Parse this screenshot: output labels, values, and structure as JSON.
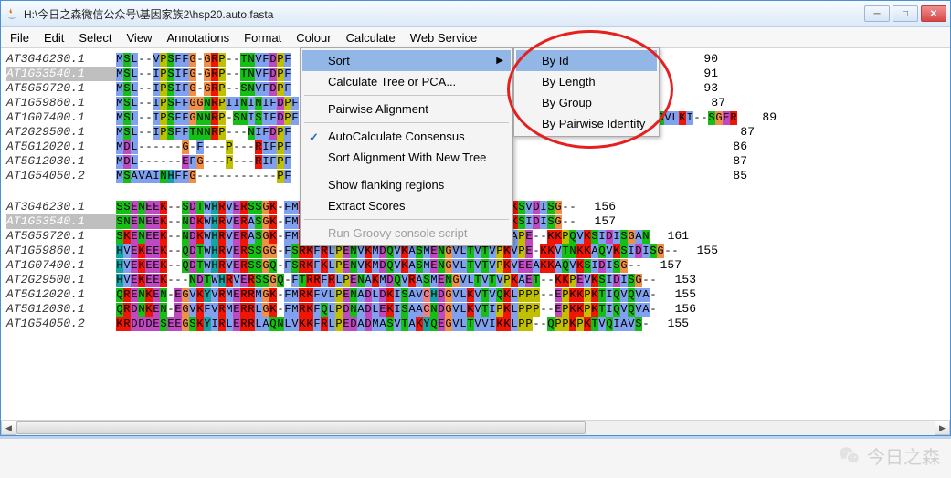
{
  "window": {
    "title": "H:\\今日之森微信公众号\\基因家族2\\hsp20.auto.fasta"
  },
  "menubar": [
    "File",
    "Edit",
    "Select",
    "View",
    "Annotations",
    "Format",
    "Colour",
    "Calculate",
    "Web Service"
  ],
  "calc_menu": {
    "sort": "Sort",
    "calc_tree": "Calculate Tree or PCA...",
    "pairwise": "Pairwise Alignment",
    "autocalc": "AutoCalculate Consensus",
    "sort_new": "Sort Alignment With New Tree",
    "flanking": "Show flanking regions",
    "extract": "Extract Scores",
    "groovy": "Run Groovy console script"
  },
  "sort_menu": {
    "by_id": "By Id",
    "by_length": "By Length",
    "by_group": "By Group",
    "by_pair": "By Pairwise Identity"
  },
  "block1": {
    "names": [
      "AT3G46230.1",
      "AT1G53540.1",
      "AT5G59720.1",
      "AT1G59860.1",
      "AT1G07400.1",
      "AT2G29500.1",
      "AT5G12020.1",
      "AT5G12030.1",
      "AT1G54050.2"
    ],
    "seqs": [
      "MSL--VPSFFG-GRP--TNVFDPF|xxxxxGSNVPDTAxxTPEGLHVFKADVPGLKKEEVKVEVEDGNILQI--SGER",
      "MSL--IPSIFG-GRP--TNVFDPF|xxxxxGSNVPDTAxxTPKGLHVFKADLPGLRKEEVKVEVEDGNILQI--SGER",
      "MSL--IPSIFG-GRP--SNVFDPF|xxxxxGSNVPDTAxxTPKGLHVFKADLPGLKKEEVKVEVEDKNVLQI--SGER",
      "MSL--IPSFFGGNRPIININIFDPF|xxxxxGSNVPDTAxxTPKGLHVFKADLPGMKKEEVKVEIEDDSVLKI--SGER",
      "MSL--IPSFFGNNRP-SNISIFDPF|xxxxxGETSxLTNLYADWVDV|KETAKAHVFKADLPGMKKEEVKVEIEDDSVLKI--SGER",
      "MSL--IPSFFTNNRP---NIFDPF|xxxxxKENSATV|WADYVDW|KETPEAHVFKADLPGLKKEEVKVEIEDDSVLKI--SGER",
      "MDL------G-F---P---RIFPF|xxxxxRDAKAMAATPADVIEEHEKAYVFEVDMPGIKGDEIQVVIENNVLVV--SGER",
      "MDL------EFG---P---RIFPF|xxxxxRDAKAMAATPADVIEHPDAYVFAVDMPGIKGDEIQVQIENENVLVV--SGKR",
      "MSAVAINHFFG-----------PF|xxxxxKGRGSSNNIPIDILESPKEYIFYLDIPGISKSDIQVTVEEERTLVIKSNGKR"
    ],
    "nums": [
      "90",
      "91",
      "93",
      "87",
      "89",
      "87",
      "86",
      "87",
      "85"
    ]
  },
  "block2": {
    "names": [
      "AT3G46230.1",
      "AT1G53540.1",
      "AT5G59720.1",
      "AT1G59860.1",
      "AT1G07400.1",
      "AT2G29500.1",
      "AT5G12020.1",
      "AT5G12030.1",
      "AT1G54050.2"
    ],
    "seqs": [
      "SSENEEK--SDTWHRVERSSGK-FMRRFRLPENAKMEEVKATPKVQE--SKPEVKSVDISG--",
      "SNENEEK--NDKWHRVERASGK-FMRRFRLPENAKMEEVKASPKVEE--KKPEVKSIDISG--",
      "SKENEEK--NDKWHRVERASGK-FMRRFRLPENAKMEEVKATMENGVLTVVVPKAPE--KKPQVKSIDISGAN",
      "HVEKEEK--QDTWHRVERSSGG-FSRKFRLPENVKMDQVKASMENGVLTVTVPKVPE-KKVTNKKAQVKSIDISG--",
      "HVEKEEK--QDTWHRVERSSGQ-FSRKFKLPENVKMDQVKASMENGVLTVTVPKVEEAKKAQVKSIDISG--",
      "HVEKEEK---NDTWHRVERSSGQ-FTRRFRLPENAKMDQVRASMENGVLTVTVPKAET--KKPEVKSIDISG--",
      "QRENKEN-EGVKYVRMERRMGK-FMRKFVLPENADLDKISAVCHDGVLKVTVQKLPPP--EPKKPKTIQVQVA-",
      "QRDNKEN-EGVKFVRMERRLGK-FMRKFQLPDNADLEKISAACNDGVLKVTIPKLPPP--EPKKPKTIQVQVA-",
      "KRDDDESEEGSKYIRLERRLAQNLVKKFRLPEDADMASVTAKYQEGVLTVVIKKLPP--QPPKPKTVQIAVS-"
    ],
    "nums": [
      "156",
      "157",
      "161",
      "155",
      "157",
      "153",
      "155",
      "156",
      "155"
    ]
  },
  "watermark": "今日之森",
  "clustal_colors": {
    "A": "#80a0f0",
    "I": "#80a0f0",
    "L": "#80a0f0",
    "M": "#80a0f0",
    "F": "#80a0f0",
    "W": "#80a0f0",
    "V": "#80a0f0",
    "R": "#f01505",
    "K": "#f01505",
    "N": "#15c015",
    "Q": "#15c015",
    "S": "#15c015",
    "T": "#15c015",
    "C": "#f08080",
    "E": "#c048c0",
    "D": "#c048c0",
    "G": "#f09048",
    "H": "#15a4a4",
    "Y": "#15a4a4",
    "P": "#c0c000"
  }
}
